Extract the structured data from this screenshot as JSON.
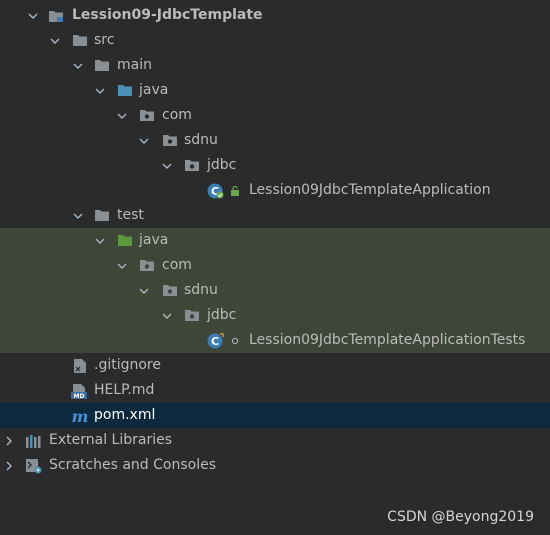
{
  "tree": {
    "project": "Lession09-JdbcTemplate",
    "src": "src",
    "main": "main",
    "main_java": "java",
    "main_com": "com",
    "main_sdnu": "sdnu",
    "main_jdbc": "jdbc",
    "main_class": "Lession09JdbcTemplateApplication",
    "test": "test",
    "test_java": "java",
    "test_com": "com",
    "test_sdnu": "sdnu",
    "test_jdbc": "jdbc",
    "test_class": "Lession09JdbcTemplateApplicationTests",
    "gitignore": ".gitignore",
    "help": "HELP.md",
    "pom": "pom.xml",
    "external_libraries": "External Libraries",
    "scratches": "Scratches and Consoles"
  },
  "colors": {
    "background": "#2b2b2b",
    "test_highlight": "#3d4637",
    "selection": "#0d293e",
    "source_folder": "#4a8fb5",
    "test_folder": "#5a9a3a",
    "folder": "#8a8f93"
  },
  "watermark": "CSDN @Beyong2019"
}
